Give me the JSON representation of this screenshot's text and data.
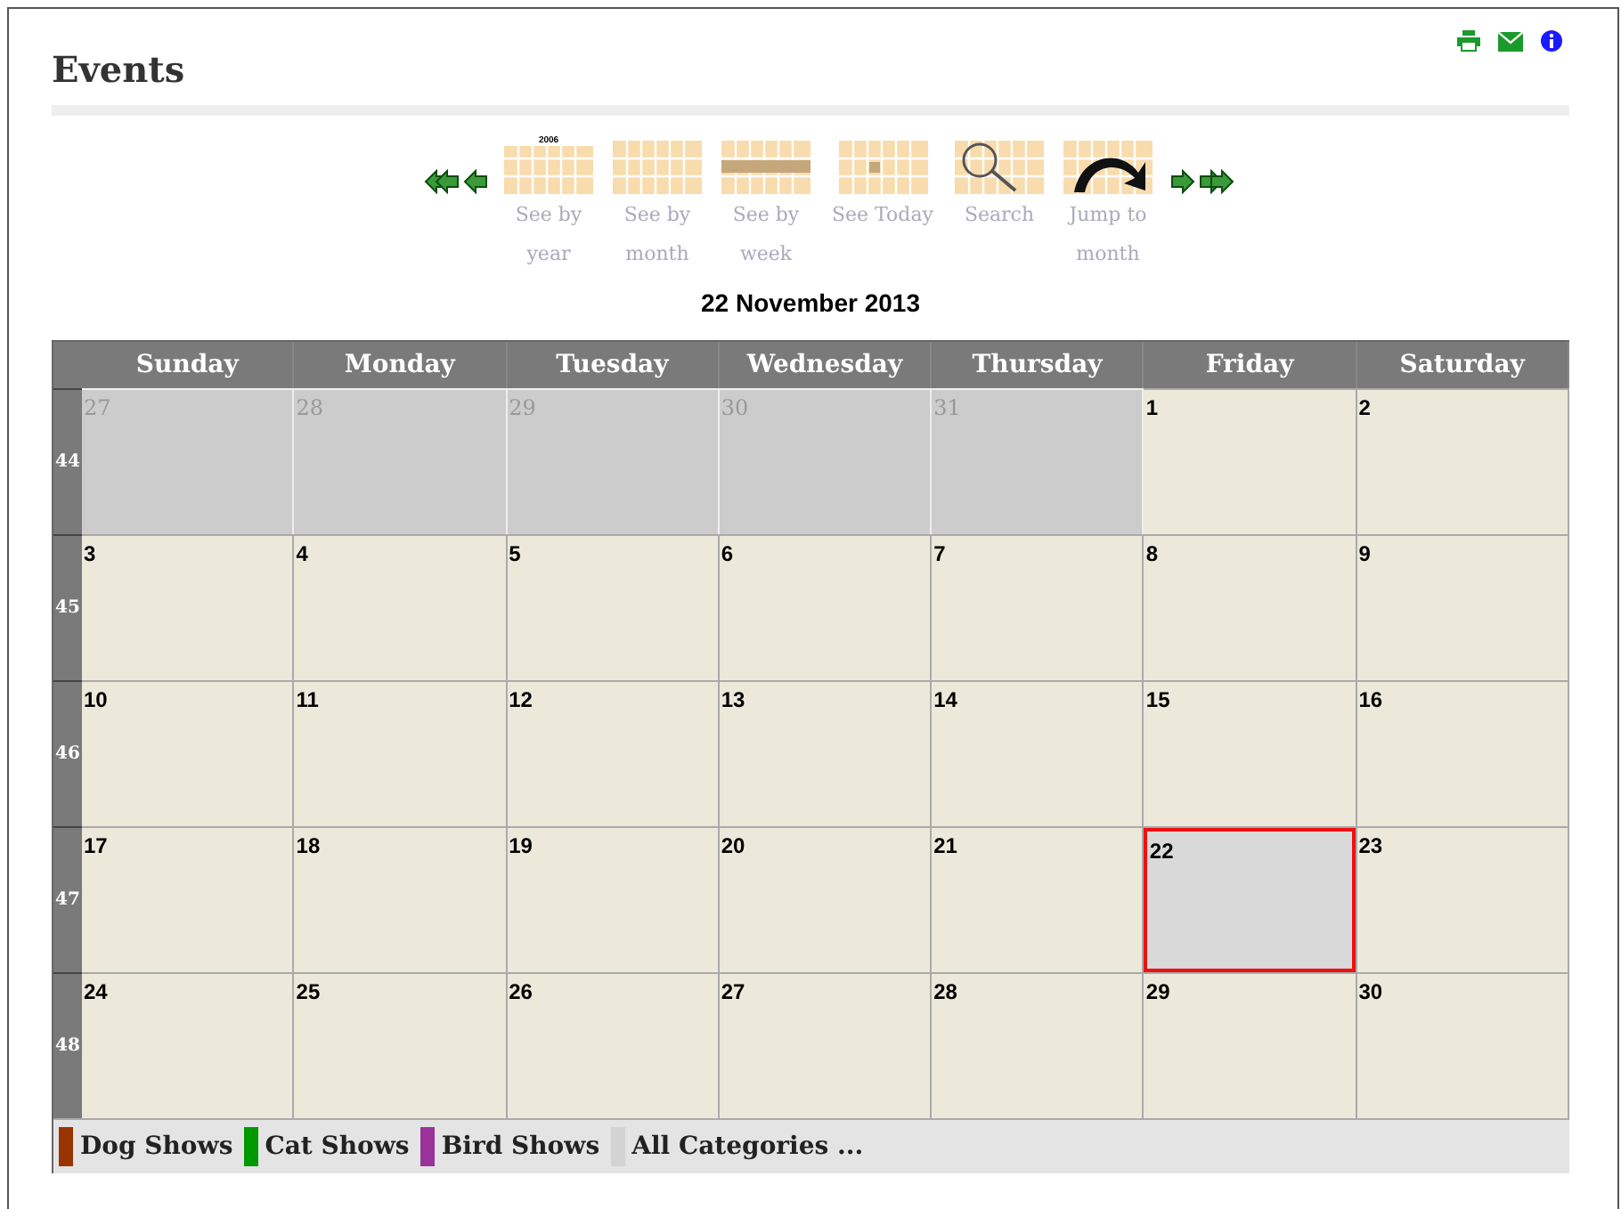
{
  "page": {
    "title": "Events"
  },
  "toolbar": [
    {
      "kind": "year",
      "label": "See by year",
      "caption": "2006"
    },
    {
      "kind": "month",
      "label": "See by month"
    },
    {
      "kind": "week",
      "label": "See by week"
    },
    {
      "kind": "today",
      "label": "See Today"
    },
    {
      "kind": "search",
      "label": "Search"
    },
    {
      "kind": "jump",
      "label": "Jump to month"
    }
  ],
  "calendar": {
    "title": "22 November 2013",
    "weekdays": [
      "Sunday",
      "Monday",
      "Tuesday",
      "Wednesday",
      "Thursday",
      "Friday",
      "Saturday"
    ],
    "weeks": [
      {
        "number": "44",
        "days": [
          {
            "label": "27",
            "other_month": true,
            "selected": false
          },
          {
            "label": "28",
            "other_month": true,
            "selected": false
          },
          {
            "label": "29",
            "other_month": true,
            "selected": false
          },
          {
            "label": "30",
            "other_month": true,
            "selected": false
          },
          {
            "label": "31",
            "other_month": true,
            "selected": false
          },
          {
            "label": "1",
            "other_month": false,
            "selected": false
          },
          {
            "label": "2",
            "other_month": false,
            "selected": false
          }
        ]
      },
      {
        "number": "45",
        "days": [
          {
            "label": "3",
            "other_month": false,
            "selected": false
          },
          {
            "label": "4",
            "other_month": false,
            "selected": false
          },
          {
            "label": "5",
            "other_month": false,
            "selected": false
          },
          {
            "label": "6",
            "other_month": false,
            "selected": false
          },
          {
            "label": "7",
            "other_month": false,
            "selected": false
          },
          {
            "label": "8",
            "other_month": false,
            "selected": false
          },
          {
            "label": "9",
            "other_month": false,
            "selected": false
          }
        ]
      },
      {
        "number": "46",
        "days": [
          {
            "label": "10",
            "other_month": false,
            "selected": false
          },
          {
            "label": "11",
            "other_month": false,
            "selected": false
          },
          {
            "label": "12",
            "other_month": false,
            "selected": false
          },
          {
            "label": "13",
            "other_month": false,
            "selected": false
          },
          {
            "label": "14",
            "other_month": false,
            "selected": false
          },
          {
            "label": "15",
            "other_month": false,
            "selected": false
          },
          {
            "label": "16",
            "other_month": false,
            "selected": false
          }
        ]
      },
      {
        "number": "47",
        "days": [
          {
            "label": "17",
            "other_month": false,
            "selected": false
          },
          {
            "label": "18",
            "other_month": false,
            "selected": false
          },
          {
            "label": "19",
            "other_month": false,
            "selected": false
          },
          {
            "label": "20",
            "other_month": false,
            "selected": false
          },
          {
            "label": "21",
            "other_month": false,
            "selected": false
          },
          {
            "label": "22",
            "other_month": false,
            "selected": true
          },
          {
            "label": "23",
            "other_month": false,
            "selected": false
          }
        ]
      },
      {
        "number": "48",
        "days": [
          {
            "label": "24",
            "other_month": false,
            "selected": false
          },
          {
            "label": "25",
            "other_month": false,
            "selected": false
          },
          {
            "label": "26",
            "other_month": false,
            "selected": false
          },
          {
            "label": "27",
            "other_month": false,
            "selected": false
          },
          {
            "label": "28",
            "other_month": false,
            "selected": false
          },
          {
            "label": "29",
            "other_month": false,
            "selected": false
          },
          {
            "label": "30",
            "other_month": false,
            "selected": false
          }
        ]
      }
    ]
  },
  "legend": [
    {
      "label": "Dog Shows",
      "color": "#993300"
    },
    {
      "label": "Cat Shows",
      "color": "#009900"
    },
    {
      "label": "Bird Shows",
      "color": "#993399"
    },
    {
      "label": "All Categories ...",
      "color": "#d3d3d3"
    }
  ]
}
